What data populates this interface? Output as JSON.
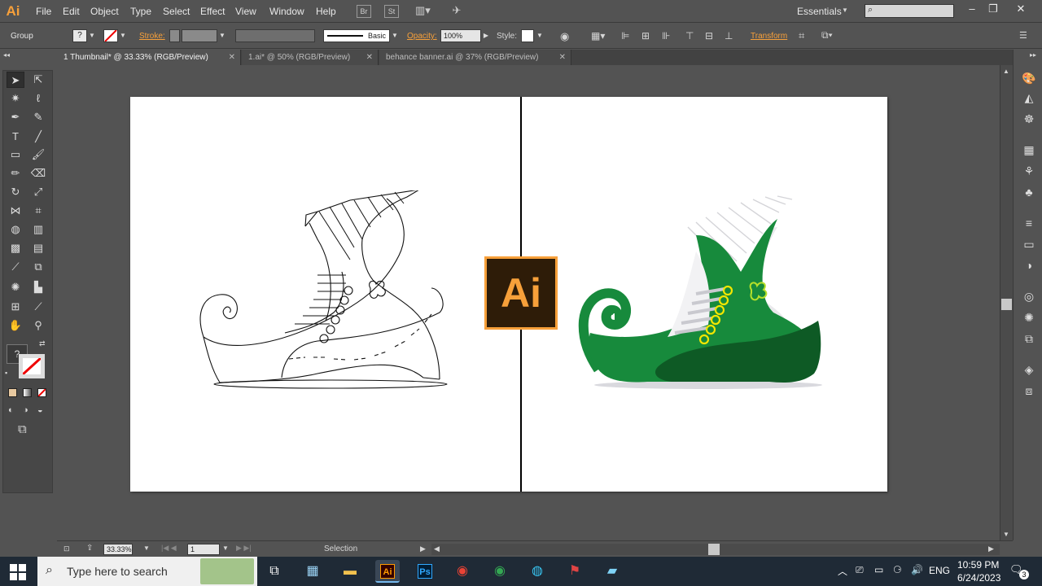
{
  "menubar": {
    "logo": "Ai",
    "items": [
      "File",
      "Edit",
      "Object",
      "Type",
      "Select",
      "Effect",
      "View",
      "Window",
      "Help"
    ],
    "workspace": "Essentials"
  },
  "controlbar": {
    "selection_type": "Group",
    "stroke_label": "Stroke:",
    "brush_label": "Basic",
    "opacity_label": "Opacity:",
    "opacity_value": "100%",
    "style_label": "Style:",
    "transform_label": "Transform"
  },
  "tabs": [
    {
      "label": "1 Thumbnail* @ 33.33% (RGB/Preview)",
      "active": true
    },
    {
      "label": "1.ai* @ 50% (RGB/Preview)",
      "active": false
    },
    {
      "label": "behance banner.ai @ 37% (RGB/Preview)",
      "active": false
    }
  ],
  "canvas": {
    "logo_text": "Ai",
    "accent": "#f7a03a",
    "shoe_green": "#178a3c",
    "shoe_dark_green": "#0e5a25"
  },
  "status": {
    "zoom": "33.33%",
    "artboard": "1",
    "tool": "Selection"
  },
  "taskbar": {
    "search_placeholder": "Type here to search",
    "language": "ENG",
    "time": "10:59 PM",
    "date": "6/24/2023",
    "notification_count": "3"
  }
}
